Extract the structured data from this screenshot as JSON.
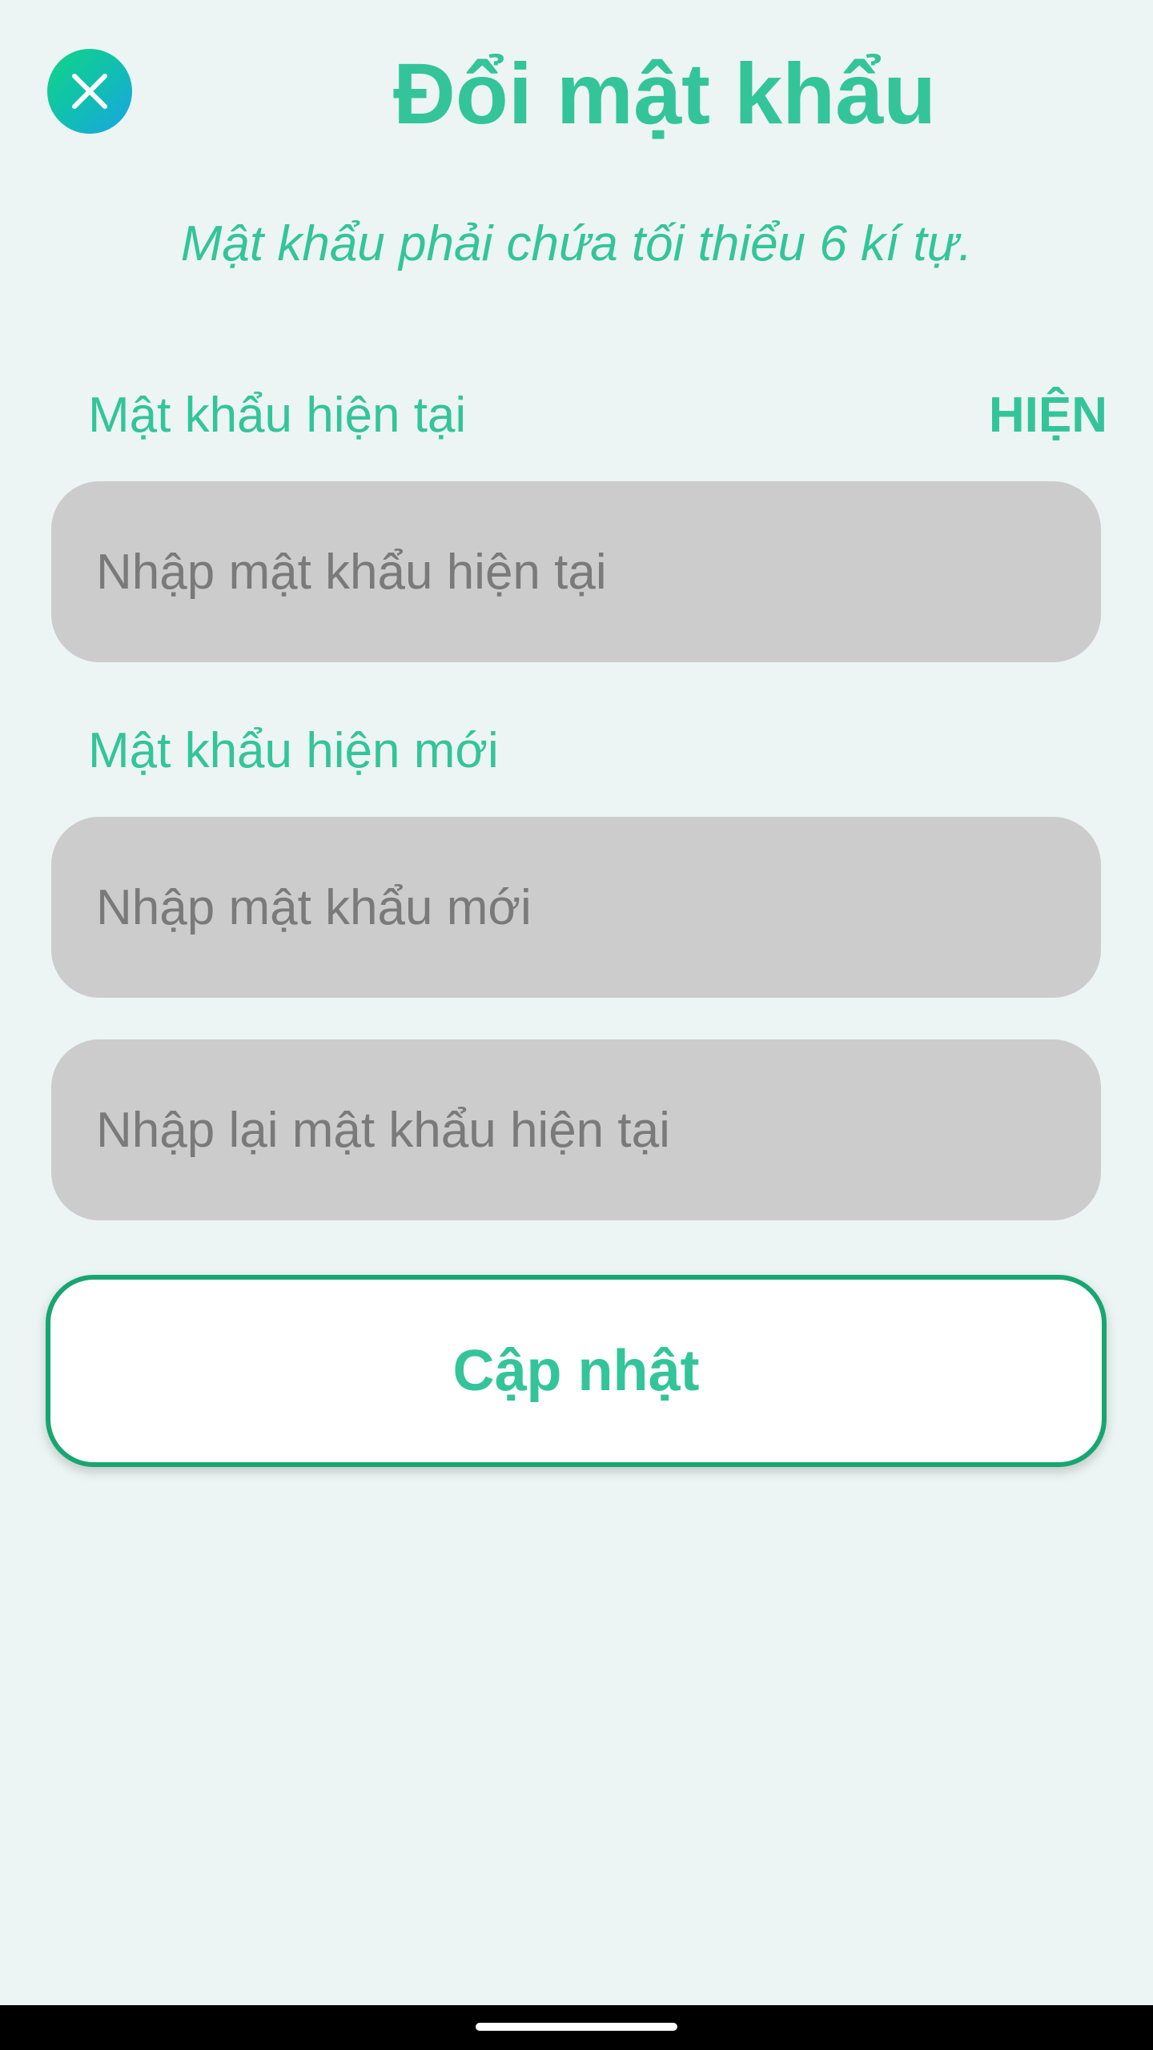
{
  "header": {
    "close_icon": "close-icon",
    "title": "Đổi mật khẩu"
  },
  "subtitle": "Mật khẩu phải chứa tối thiểu 6 kí tự.",
  "current_password": {
    "label": "Mật khẩu hiện tại",
    "show_toggle": "HIỆN",
    "placeholder": "Nhập mật khẩu hiện tại",
    "value": ""
  },
  "new_password": {
    "label": "Mật khẩu hiện mới",
    "placeholder": "Nhập mật khẩu mới",
    "value": ""
  },
  "confirm_password": {
    "placeholder": "Nhập lại mật khẩu hiện tại",
    "value": ""
  },
  "update_button": {
    "label": "Cập nhật"
  },
  "colors": {
    "accent": "#34c49a",
    "background": "#ecf5f3",
    "input_background": "#cccccc",
    "button_border": "#17a672"
  }
}
